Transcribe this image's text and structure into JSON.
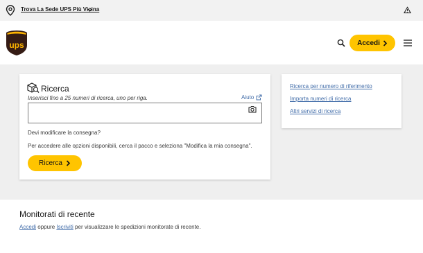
{
  "topbar": {
    "location_link": "Trova La Sede UPS Più Vicina"
  },
  "header": {
    "logo_text": "ups",
    "login_label": "Accedi"
  },
  "tracking": {
    "title": "Ricerca",
    "hint": "Inserisci fino a 25 numeri di ricerca, uno per riga.",
    "help_link": "Aiuto",
    "input_value": "",
    "modify_question": "Devi modificare la consegna?",
    "modify_description": "Per accedere alle opzioni disponibili, cerca il pacco e seleziona \"Modifica la mia consegna\".",
    "button_label": "Ricerca"
  },
  "side_links": [
    "Ricerca per numero di riferimento",
    "Importa numeri di ricerca",
    "Altri servizi di ricerca"
  ],
  "recent": {
    "title": "Monitorati di recente",
    "login_link": "Accedi",
    "or_text": " oppure ",
    "register_link": "Iscriviti",
    "suffix_text": " per visualizzare le spedizioni monitorate di recente."
  },
  "colors": {
    "accent_yellow": "#ffc400",
    "brand_brown": "#351c15",
    "link_blue": "#426da9",
    "band_grey": "#efefef"
  },
  "icons": [
    "location-pin-icon",
    "chevron-down-icon",
    "alert-triangle-icon",
    "search-icon",
    "chevron-right-icon",
    "hamburger-menu-icon",
    "track-package-icon",
    "external-link-icon",
    "camera-icon"
  ]
}
